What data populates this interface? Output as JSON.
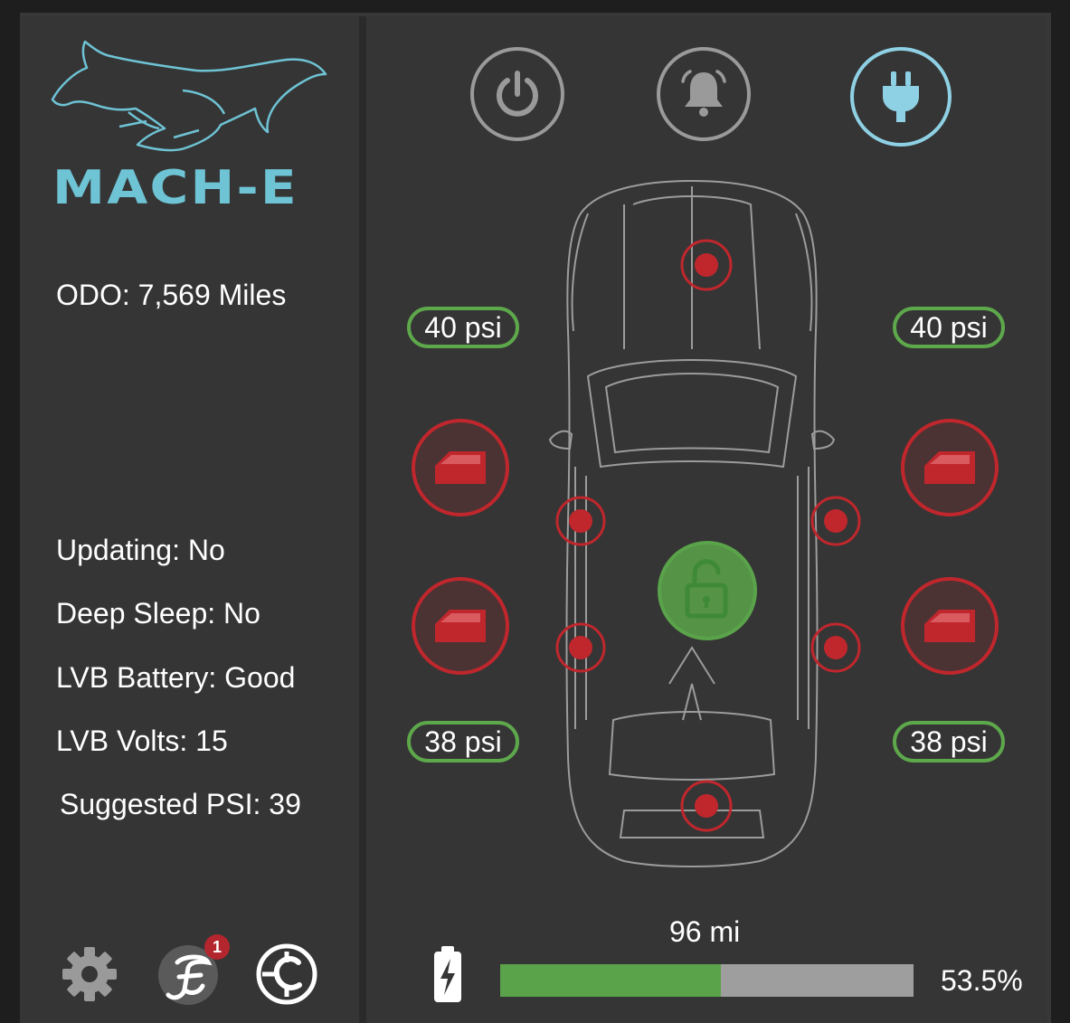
{
  "brand": {
    "logo_text": "MACH-E",
    "logo_icon": "mustang-pony-icon",
    "accent_color": "#6ec3d4"
  },
  "vehicle": {
    "odometer": "ODO: 7,569 Miles",
    "updating": "Updating: No",
    "deep_sleep": "Deep Sleep: No",
    "lvb_battery": "LVB Battery: Good",
    "lvb_volts": "LVB Volts: 15",
    "suggested_psi": "Suggested PSI: 39"
  },
  "controls": {
    "power": {
      "icon": "power-icon",
      "active": false
    },
    "alarm": {
      "icon": "bell-icon",
      "active": false
    },
    "charge": {
      "icon": "plug-icon",
      "active": true
    }
  },
  "tires": {
    "front_left": "40 psi",
    "front_right": "40 psi",
    "rear_left": "38 psi",
    "rear_right": "38 psi",
    "ok_color": "#5ea84c"
  },
  "doors": {
    "front_left": "open",
    "front_right": "open",
    "rear_left": "open",
    "rear_right": "open",
    "alert_color": "#c0272d"
  },
  "lock": {
    "state": "unlocked",
    "color": "#5aa34a"
  },
  "charge": {
    "range": "96 mi",
    "percent_label": "53.5%",
    "level_fraction": 0.535,
    "icon": "battery-bolt-icon"
  },
  "footer": {
    "settings_icon": "gear-icon",
    "fordpass_icon": "fordpass-logo-icon",
    "notification_count": "1",
    "charger_icon": "charging-connector-icon"
  }
}
